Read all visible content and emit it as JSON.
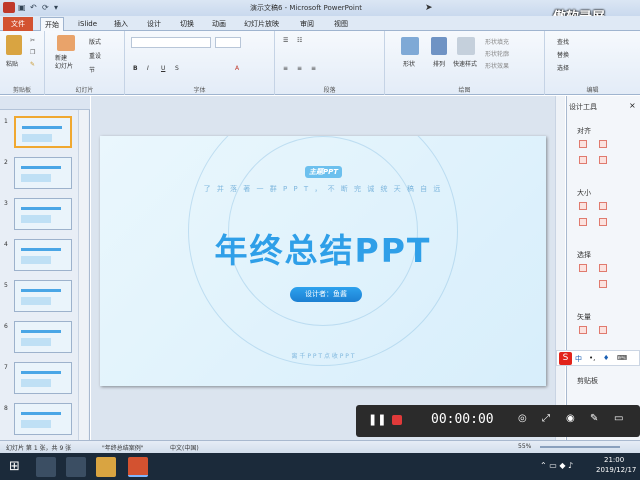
{
  "window": {
    "title": "演示文稿6 - Microsoft PowerPoint",
    "watermark": "傲软录屏"
  },
  "tabs": [
    "文件",
    "开始",
    "iSlide",
    "插入",
    "设计",
    "切换",
    "动画",
    "幻灯片放映",
    "审阅",
    "视图"
  ],
  "ribbon": {
    "groups": [
      "剪贴板",
      "幻灯片",
      "字体",
      "段落",
      "绘图",
      "编辑"
    ],
    "paste": "粘贴",
    "new_slide": "新建\n幻灯片",
    "layout": "版式",
    "reset": "重设",
    "section": "节",
    "shape": "形状",
    "arrange": "排列",
    "quick_styles": "快速样式",
    "shape_fill": "形状填充",
    "shape_outline": "形状轮廓",
    "shape_effects": "形状效果",
    "find": "查找",
    "replace": "替换",
    "select": "选择"
  },
  "slide": {
    "logo": "主题PPT",
    "slogan": "了 并 落 著 一 群 P P T ， 不 断 完 诚 统 天 稿 自 远",
    "title": "年终总结PPT",
    "designer": "设计者：鱼酱",
    "footer": "离 千 P P T     点 收 P P T"
  },
  "thumbnails": [
    1,
    2,
    3,
    4,
    5,
    6,
    7,
    8
  ],
  "right_pane": {
    "title": "设计工具",
    "sections": [
      "对齐",
      "大小",
      "选择",
      "矢量",
      "剪贴板"
    ]
  },
  "recorder": {
    "time": "00:00:00"
  },
  "statusbar": {
    "slide_info": "幻灯片 第 1 张，共 9 张",
    "theme": "\"年终总结案例\"",
    "lang": "中文(中国)",
    "zoom": "55%"
  },
  "taskbar": {
    "time": "21:00",
    "date": "2019/12/17"
  }
}
